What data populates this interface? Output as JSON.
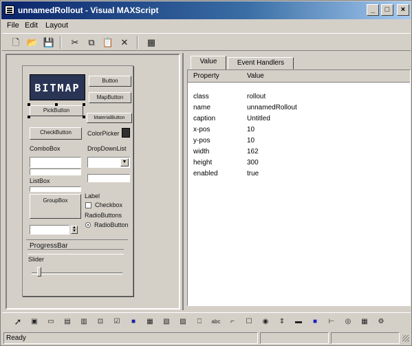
{
  "window": {
    "title": "unnamedRollout - Visual MAXScript",
    "minimize": "_",
    "maximize": "□",
    "close": "×"
  },
  "menu": {
    "items": [
      "File",
      "Edit",
      "Layout"
    ]
  },
  "toolbar": {
    "icons": [
      "new-icon",
      "open-icon",
      "save-icon",
      "cut-icon",
      "copy-icon",
      "paste-icon",
      "delete-icon",
      "grid-icon"
    ]
  },
  "rollout": {
    "bitmap": "BITMAP",
    "button": "Button",
    "mapbutton": "MapButton",
    "pickbutton": "PickButton",
    "materialbutton": "MaterialButton",
    "checkbutton": "CheckButton",
    "colorpicker": "ColorPicker",
    "combobox": "ComboBox",
    "dropdownlist": "DropDownList",
    "listbox": "ListBox",
    "groupbox": "GroupBox",
    "label": "Label",
    "checkbox": "Checkbox",
    "radiobuttons": "RadioButtons",
    "radiobutton": "RadioButton",
    "progressbar": "ProgressBar",
    "slider": "Slider"
  },
  "tabs": [
    "Value",
    "Event Handlers"
  ],
  "properties": {
    "header": {
      "property": "Property",
      "value": "Value"
    },
    "rows": [
      {
        "name": "class",
        "value": "rollout"
      },
      {
        "name": "name",
        "value": "unnamedRollout"
      },
      {
        "name": "caption",
        "value": "Untitled"
      },
      {
        "name": "x-pos",
        "value": "10"
      },
      {
        "name": "y-pos",
        "value": "10"
      },
      {
        "name": "width",
        "value": "162"
      },
      {
        "name": "height",
        "value": "300"
      },
      {
        "name": "enabled",
        "value": "true"
      }
    ]
  },
  "status": {
    "text": "Ready"
  }
}
